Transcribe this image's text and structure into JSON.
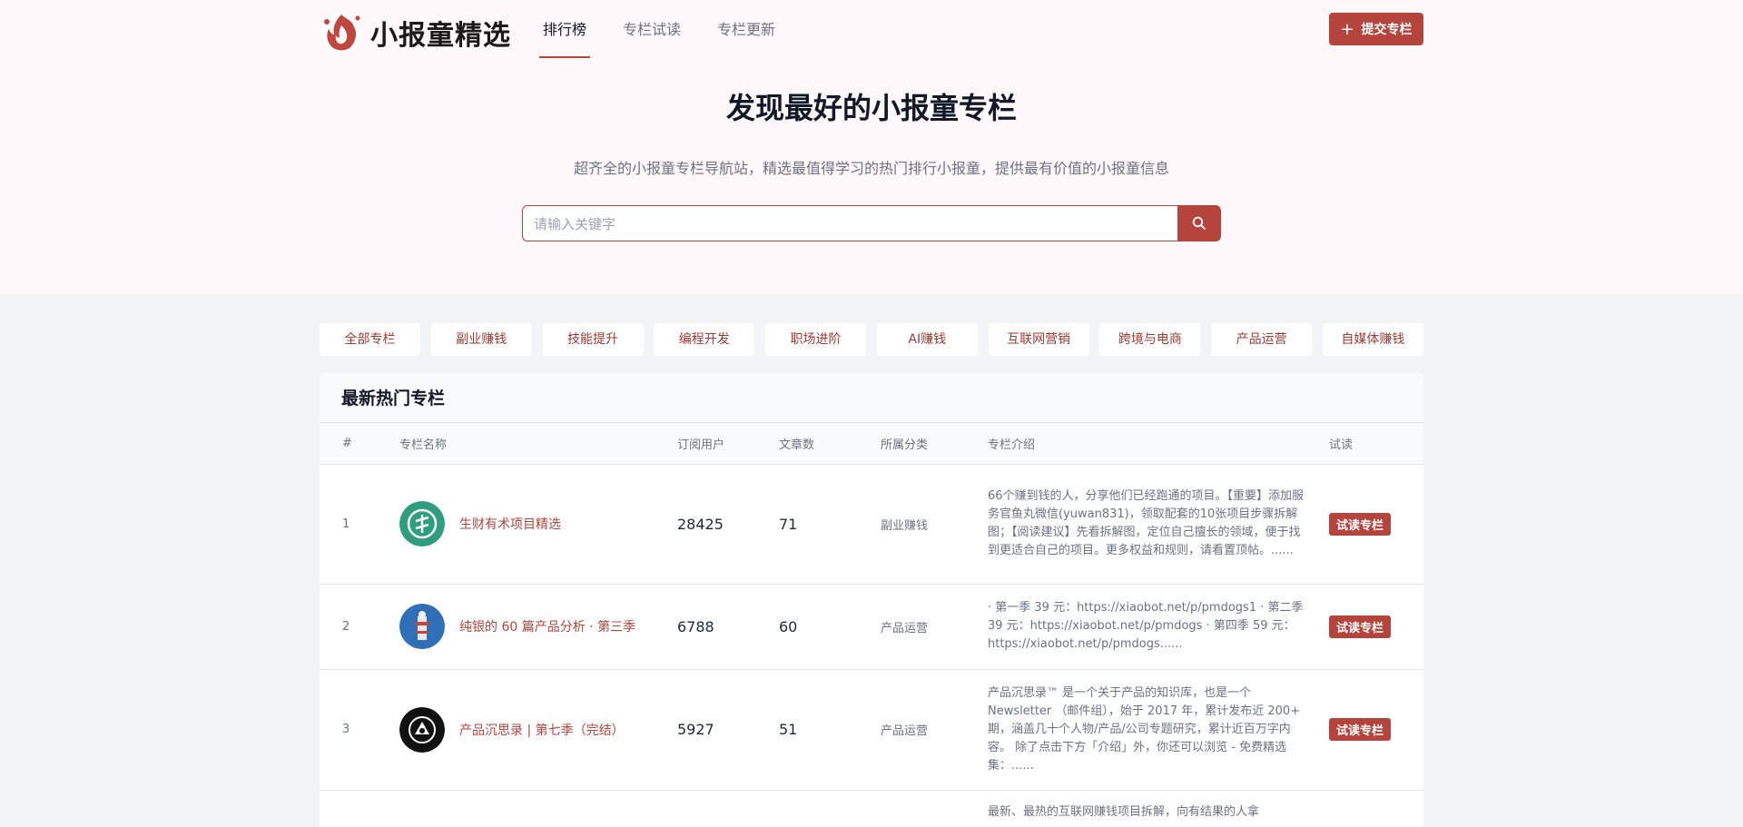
{
  "brand": {
    "name": "小报童精选",
    "accent": "#b5443c"
  },
  "nav": {
    "tabs": [
      "排行榜",
      "专栏试读",
      "专栏更新"
    ],
    "submit_label": "提交专栏"
  },
  "hero": {
    "title": "发现最好的小报童专栏",
    "subtitle": "超齐全的小报童专栏导航站，精选最值得学习的热门排行小报童，提供最有价值的小报童信息",
    "search_placeholder": "请输入关键字"
  },
  "categories": [
    "全部专栏",
    "副业赚钱",
    "技能提升",
    "编程开发",
    "职场进阶",
    "AI赚钱",
    "互联网营销",
    "跨境与电商",
    "产品运营",
    "自媒体赚钱"
  ],
  "table": {
    "title": "最新热门专栏",
    "headers": [
      "#",
      "专栏名称",
      "订阅用户",
      "文章数",
      "所属分类",
      "专栏介绍",
      "试读"
    ],
    "try_label": "试读专栏",
    "rows": [
      {
        "rank": "1",
        "name": "生财有术项目精选",
        "subs": "28425",
        "articles": "71",
        "category": "副业赚钱",
        "desc": "66个赚到钱的人，分享他们已经跑通的项目。【重要】添加服务官鱼丸微信(yuwan831)，领取配套的10张项目步骤拆解图；【阅读建议】先看拆解图，定位自己擅长的领域，便于找到更适合自己的项目。更多权益和规则，请看置顶帖。......"
      },
      {
        "rank": "2",
        "name": "纯银的 60 篇产品分析 · 第三季",
        "subs": "6788",
        "articles": "60",
        "category": "产品运营",
        "desc": "· 第一季 39 元：https://xiaobot.net/p/pmdogs1 · 第二季 39 元：https://xiaobot.net/p/pmdogs · 第四季 59 元：https://xiaobot.net/p/pmdogs......"
      },
      {
        "rank": "3",
        "name": "产品沉思录 | 第七季（完结）",
        "subs": "5927",
        "articles": "51",
        "category": "产品运营",
        "desc": "产品沉思录™ 是一个关于产品的知识库，也是一个 Newsletter （邮件组），始于 2017 年，累计发布近 200+ 期，涵盖几十个人物/产品/公司专题研究，累计近百万字内容。 除了点击下方「介绍」外，你还可以浏览 - 免费精选集：......"
      },
      {
        "rank": "",
        "name": "",
        "subs": "",
        "articles": "",
        "category": "",
        "desc": "最新、最热的互联网赚钱项目拆解，向有结果的人拿"
      }
    ]
  }
}
